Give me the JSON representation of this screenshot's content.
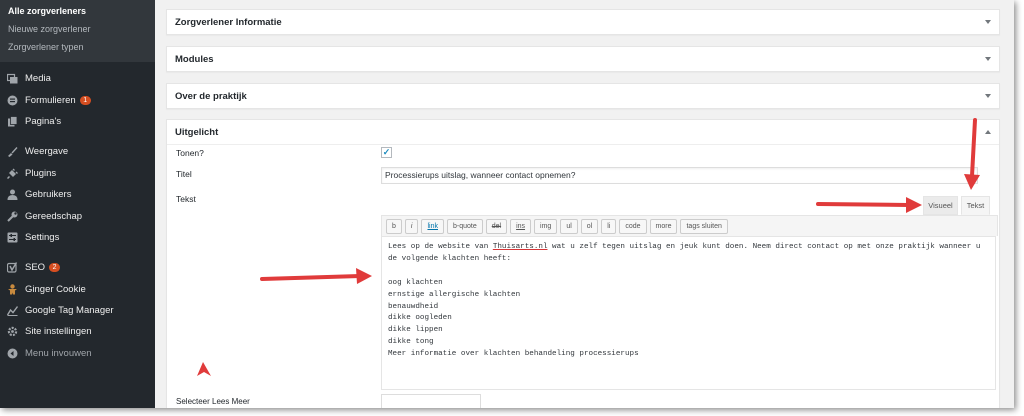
{
  "sidebar": {
    "submenu": [
      {
        "label": "Alle zorgverleners",
        "current": true
      },
      {
        "label": "Nieuwe zorgverlener",
        "current": false
      },
      {
        "label": "Zorgverlener typen",
        "current": false
      }
    ],
    "items": [
      {
        "label": "Media",
        "icon": "media-icon"
      },
      {
        "label": "Formulieren",
        "icon": "forms-icon",
        "badge": "1"
      },
      {
        "label": "Pagina's",
        "icon": "pages-icon"
      },
      {
        "label": "Weergave",
        "icon": "appearance-icon"
      },
      {
        "label": "Plugins",
        "icon": "plugins-icon"
      },
      {
        "label": "Gebruikers",
        "icon": "users-icon"
      },
      {
        "label": "Gereedschap",
        "icon": "tools-icon"
      },
      {
        "label": "Settings",
        "icon": "settings-icon"
      },
      {
        "label": "SEO",
        "icon": "seo-icon",
        "badge": "2"
      },
      {
        "label": "Ginger Cookie",
        "icon": "cookie-icon"
      },
      {
        "label": "Google Tag Manager",
        "icon": "tag-manager-icon"
      },
      {
        "label": "Site instellingen",
        "icon": "site-settings-icon"
      },
      {
        "label": "Menu invouwen",
        "icon": "collapse-icon"
      }
    ]
  },
  "boxes": {
    "zorgverlener": "Zorgverlener Informatie",
    "modules": "Modules",
    "praktijk": "Over de praktijk",
    "uitgelicht": "Uitgelicht"
  },
  "uitgelicht": {
    "tonen_label": "Tonen?",
    "tonen_checked": true,
    "titel_label": "Titel",
    "titel_value": "Processierups uitslag, wanneer contact opnemen?",
    "tekst_label": "Tekst",
    "tab_visual": "Visueel",
    "tab_text": "Tekst",
    "quicktags": [
      "b",
      "i",
      "link",
      "b-quote",
      "del",
      "ins",
      "img",
      "ul",
      "ol",
      "li",
      "code",
      "more",
      "tags sluiten"
    ],
    "editor": {
      "line1_pre": "Lees op de website van ",
      "line1_link": "Thuisarts.nl",
      "line1_post": " wat u zelf tegen uitslag en jeuk kunt doen. Neem direct contact op met onze praktijk wanneer u",
      "line2": "de volgende klachten heeft:",
      "line3": "",
      "line4": "oog klachten",
      "line5": "ernstige allergische klachten",
      "line6": "benauwdheid",
      "line7": "dikke oogleden",
      "line8": "dikke lippen",
      "line9": "dikke tong",
      "line10": "Meer informatie over klachten behandeling processierups"
    },
    "bottom_label": "Selecteer Lees Meer"
  },
  "colors": {
    "sidebar_bg": "#23282d",
    "submenu_bg": "#32373c",
    "badge": "#d54e21",
    "arrow": "#e03b3b"
  }
}
